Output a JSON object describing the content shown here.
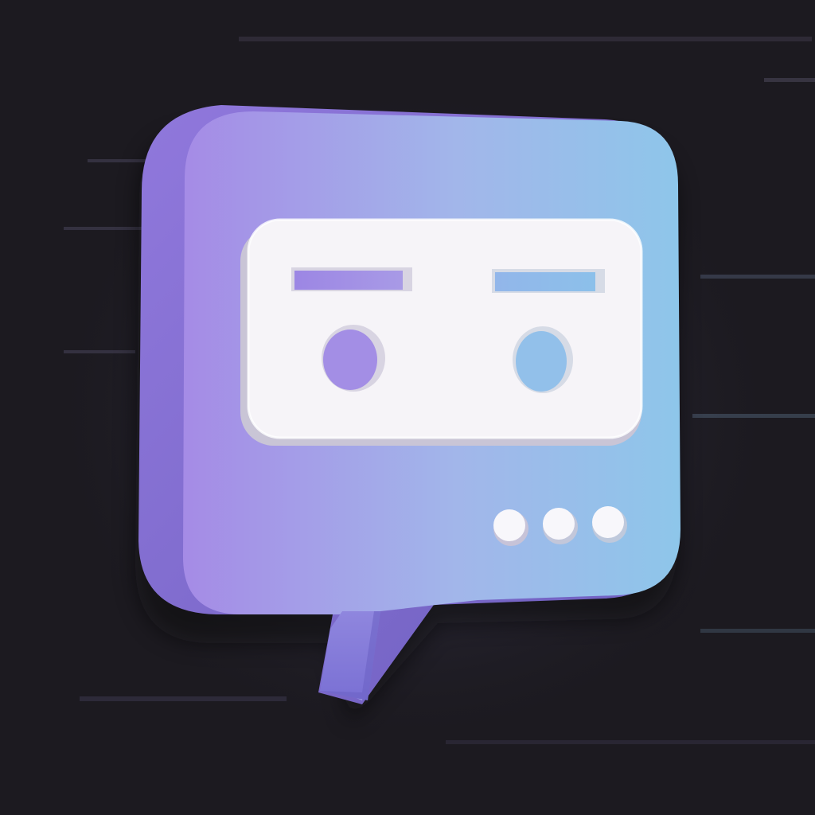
{
  "scene": {
    "background_color": "#1c1a20",
    "icon_semantic": "chat-bot-icon",
    "bubble": {
      "gradient_start": "#a58be6",
      "gradient_end": "#8ec6ea",
      "side_shade": "#7f6fd2"
    },
    "face_plate": {
      "color": "#f6f4f8",
      "shadow": "#c9c5d6"
    },
    "typing_indicator": {
      "dot_count": 3,
      "dot_color": "#f8f7fb"
    }
  }
}
